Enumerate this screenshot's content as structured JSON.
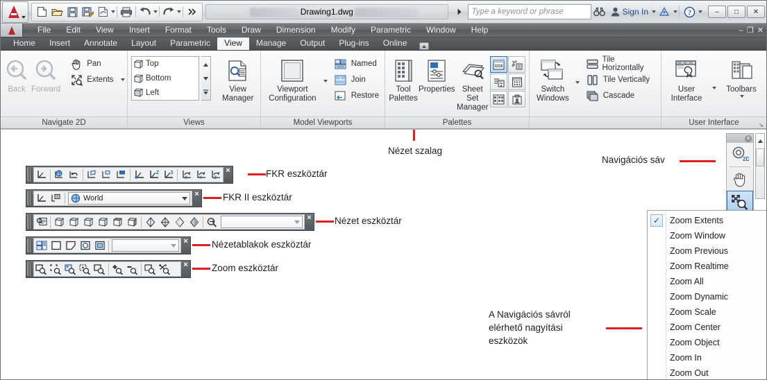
{
  "titlebar": {
    "app_icon": "autocad-a-logo",
    "quick_access": [
      {
        "name": "new-file",
        "icon": "page-icon"
      },
      {
        "name": "open-file",
        "icon": "folder-open-icon"
      },
      {
        "name": "save-file",
        "icon": "floppy-disk-icon"
      },
      {
        "name": "save-as",
        "icon": "floppy-pencil-icon"
      },
      {
        "name": "plot-preview",
        "icon": "page-plot-icon"
      },
      {
        "name": "plot",
        "icon": "printer-icon"
      },
      {
        "name": "undo",
        "icon": "undo-arrow-icon"
      },
      {
        "name": "redo",
        "icon": "redo-arrow-icon"
      },
      {
        "name": "qat-overflow",
        "icon": "double-chevron-right-icon"
      }
    ],
    "document_title": "Drawing1.dwg",
    "search_placeholder": "Type a keyword or phrase",
    "sign_in_label": "Sign In",
    "icons": [
      "binoculars-icon",
      "person-icon",
      "autodesk-360-icon",
      "help-question-icon"
    ],
    "window_buttons": {
      "minimize": "–",
      "maximize": "□",
      "close": "✕"
    }
  },
  "menubar": {
    "items": [
      "File",
      "Edit",
      "View",
      "Insert",
      "Format",
      "Tools",
      "Draw",
      "Dimension",
      "Modify",
      "Parametric",
      "Window",
      "Help"
    ],
    "doc_window_buttons": {
      "minimize": "–",
      "restore": "❐",
      "close": "✕"
    }
  },
  "ribbon_tabs": {
    "items": [
      "Home",
      "Insert",
      "Annotate",
      "Layout",
      "Parametric",
      "View",
      "Manage",
      "Output",
      "Plug-ins",
      "Online"
    ],
    "active": "View"
  },
  "ribbon": {
    "panels": [
      {
        "title": "Navigate 2D",
        "big_buttons": [
          {
            "label_line1": "Back",
            "label_line2": "",
            "icon": "zoom-back-arrow-icon",
            "disabled": true
          },
          {
            "label_line1": "Forward",
            "label_line2": "",
            "icon": "zoom-forward-arrow-icon",
            "disabled": true
          }
        ],
        "small_buttons": [
          {
            "label": "Pan",
            "icon": "hand-pan-icon",
            "has_dropdown": false
          },
          {
            "label": "Extents",
            "icon": "zoom-extents-icon",
            "has_dropdown": true
          }
        ]
      },
      {
        "title": "Views",
        "list_items": [
          {
            "label": "Top",
            "icon": "view-cube-top-icon"
          },
          {
            "label": "Bottom",
            "icon": "view-cube-bottom-icon"
          },
          {
            "label": "Left",
            "icon": "view-cube-left-icon"
          }
        ],
        "scroll_buttons": [
          "scroll-up-icon",
          "scroll-down-icon",
          "scroll-list-icon"
        ],
        "big_buttons": [
          {
            "label_line1": "View",
            "label_line2": "Manager",
            "icon": "view-manager-icon",
            "disabled": false
          }
        ]
      },
      {
        "title": "Model Viewports",
        "big_buttons": [
          {
            "label_line1": "Viewport",
            "label_line2": "Configuration",
            "icon": "viewport-square-icon",
            "has_dropdown": true
          }
        ],
        "small_buttons": [
          {
            "label": "Named",
            "icon": "named-viewport-icon"
          },
          {
            "label": "Join",
            "icon": "join-viewport-icon"
          },
          {
            "label": "Restore",
            "icon": "restore-viewport-icon"
          }
        ]
      },
      {
        "title": "Palettes",
        "big_buttons": [
          {
            "label_line1": "Tool",
            "label_line2": "Palettes",
            "icon": "tool-palettes-icon"
          },
          {
            "label_line1": "Properties",
            "label_line2": "",
            "icon": "properties-icon"
          },
          {
            "label_line1": "Sheet Set",
            "label_line2": "Manager",
            "icon": "sheet-set-manager-icon"
          }
        ],
        "icon_grid": [
          {
            "name": "command-line-palette-icon",
            "selected": true
          },
          {
            "name": "external-references-icon",
            "selected": false
          },
          {
            "name": "quickcalc-sheet-icon",
            "selected": false
          },
          {
            "name": "calculator-icon",
            "selected": false
          },
          {
            "name": "design-center-icon",
            "selected": false
          },
          {
            "name": "markup-set-manager-icon",
            "selected": false
          }
        ]
      },
      {
        "title": "",
        "big_buttons": [
          {
            "label_line1": "Switch",
            "label_line2": "Windows",
            "icon": "switch-windows-icon",
            "has_dropdown": true
          }
        ],
        "small_buttons": [
          {
            "label": "Tile Horizontally",
            "icon": "tile-horizontal-icon"
          },
          {
            "label": "Tile Vertically",
            "icon": "tile-vertical-icon"
          },
          {
            "label": "Cascade",
            "icon": "cascade-icon"
          }
        ]
      },
      {
        "title": "User Interface",
        "expand_glyph": "↘",
        "big_buttons": [
          {
            "label_line1": "User",
            "label_line2": "Interface",
            "icon": "user-interface-icon",
            "has_dropdown": true
          },
          {
            "label_line1": "Toolbars",
            "label_line2": "",
            "icon": "toolbars-icon",
            "has_dropdown": true
          }
        ]
      }
    ]
  },
  "canvas": {
    "toolbars": [
      {
        "name": "ucs-toolbar",
        "icons": [
          "ucs-icon",
          "ucs-world-icon",
          "ucs-previous-icon",
          "ucs-face-icon",
          "ucs-object-icon",
          "ucs-view-icon",
          "ucs-origin-icon",
          "ucs-z-axis-vector-icon",
          "ucs-3point-icon",
          "ucs-x-rotate-icon",
          "ucs-y-rotate-icon",
          "ucs-z-rotate-icon"
        ],
        "close": "×"
      },
      {
        "name": "ucs-ii-toolbar",
        "icons": [
          "ucs-icon",
          "ucs-named-icon"
        ],
        "combo_value": "World",
        "combo_icon": "world-globe-icon",
        "close": "×"
      },
      {
        "name": "view-toolbar",
        "icons": [
          "named-views-icon",
          "view-sw-iso-icon",
          "view-se-iso-icon",
          "view-ne-iso-icon",
          "view-nw-iso-icon",
          "view-top-icon",
          "view-bottom-icon",
          "shade-2d-wireframe-icon",
          "shade-3d-wireframe-icon",
          "shade-hidden-icon",
          "shade-conceptual-icon",
          "camera-adjust-icon"
        ],
        "combo_value": "",
        "close": "×"
      },
      {
        "name": "viewports-toolbar",
        "icons": [
          "display-viewports-dialog-icon",
          "single-viewport-icon",
          "polygonal-viewport-icon",
          "convert-object-to-viewport-icon",
          "clip-existing-viewport-icon"
        ],
        "combo_value": "",
        "close": "×"
      },
      {
        "name": "zoom-toolbar",
        "icons": [
          "zoom-window-icon",
          "zoom-dynamic-icon",
          "zoom-scale-icon",
          "zoom-center-icon",
          "zoom-object-icon",
          "zoom-in-icon",
          "zoom-out-icon",
          "zoom-all-icon",
          "zoom-extents-icon"
        ],
        "close": "×"
      }
    ],
    "annotations": [
      {
        "name": "ribbon-annotation",
        "text": "Nézet szalag"
      },
      {
        "name": "ucs-toolbar-annotation",
        "text": "FKR eszköztár"
      },
      {
        "name": "ucs-ii-toolbar-annotation",
        "text": "FKR II eszköztár"
      },
      {
        "name": "view-toolbar-annotation",
        "text": "Nézet eszköztár"
      },
      {
        "name": "viewports-toolbar-annotation",
        "text": "Nézetablakok eszköztár"
      },
      {
        "name": "zoom-toolbar-annotation",
        "text": "Zoom eszköztár"
      },
      {
        "name": "navigation-bar-annotation",
        "text": "Navigációs sáv"
      },
      {
        "name": "zoom-menu-annotation-line1",
        "text": "A Navigációs sávról"
      },
      {
        "name": "zoom-menu-annotation-line2",
        "text": "elérhető nagyítási"
      },
      {
        "name": "zoom-menu-annotation-line3",
        "text": "eszközök"
      }
    ],
    "leader_color": "#e02020",
    "navigation_bar": {
      "close_glyph": "✕",
      "items": [
        {
          "name": "steering-wheel-2d-icon",
          "label": "2D",
          "selected": false
        },
        {
          "name": "pan-hand-icon",
          "label": "",
          "selected": false
        },
        {
          "name": "zoom-extents-icon",
          "label": "",
          "selected": true
        }
      ],
      "more_glyph": "▾"
    },
    "zoom_menu": {
      "checked_index": 0,
      "check_glyph": "✓",
      "items": [
        "Zoom Extents",
        "Zoom Window",
        "Zoom Previous",
        "Zoom Realtime",
        "Zoom All",
        "Zoom Dynamic",
        "Zoom Scale",
        "Zoom Center",
        "Zoom Object",
        "Zoom In",
        "Zoom Out"
      ]
    }
  },
  "colors": {
    "accent_red": "#e02020",
    "selection_blue": "#2f6fb5",
    "menu_dark": "#55595d",
    "canvas_bg": "#ffffff"
  }
}
